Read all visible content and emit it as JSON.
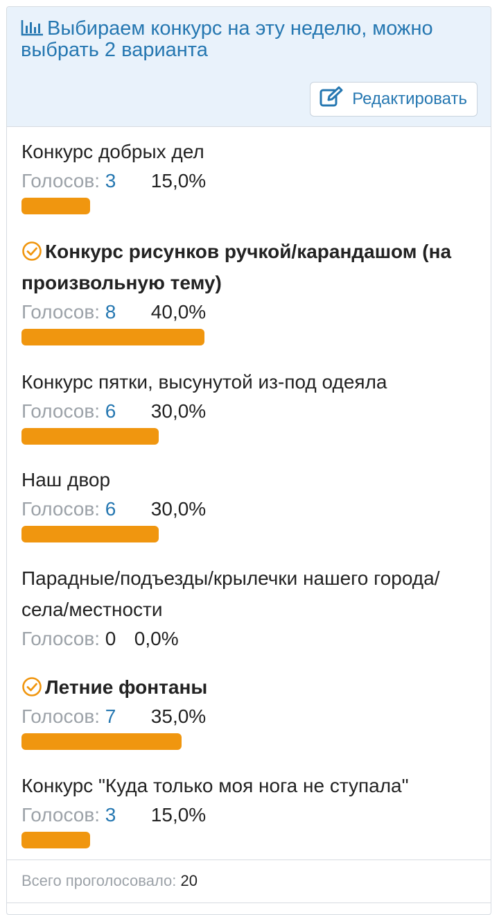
{
  "poll": {
    "title": "Выбираем конкурс на эту неделю, можно выбрать 2 варианта",
    "edit_label": "Редактировать",
    "votes_label": "Голосов:",
    "options": [
      {
        "label": "Конкурс добрых дел",
        "votes": "3",
        "percent": "15,0%",
        "share": 0.15,
        "selected": false
      },
      {
        "label": "Конкурс рисунков ручкой/карандашом (на произвольную тему)",
        "votes": "8",
        "percent": "40,0%",
        "share": 0.4,
        "selected": true
      },
      {
        "label": "Конкурс пятки, высунутой из-под одеяла",
        "votes": "6",
        "percent": "30,0%",
        "share": 0.3,
        "selected": false
      },
      {
        "label": "Наш двор",
        "votes": "6",
        "percent": "30,0%",
        "share": 0.3,
        "selected": false
      },
      {
        "label": "Парадные/подъезды/крылечки нашего города/села/местности",
        "votes": "0",
        "percent": "0,0%",
        "share": 0.0,
        "selected": false
      },
      {
        "label": "Летние фонтаны",
        "votes": "7",
        "percent": "35,0%",
        "share": 0.35,
        "selected": true
      },
      {
        "label": "Конкурс \"Куда только моя нога не ступала\"",
        "votes": "3",
        "percent": "15,0%",
        "share": 0.15,
        "selected": false
      }
    ],
    "total_label": "Всего проголосовало:",
    "total": "20"
  },
  "colors": {
    "accent": "#2577b1",
    "bar": "#f0960f",
    "header_bg": "#e9f2fb"
  },
  "icons": {
    "title": "bar-chart-icon",
    "edit": "edit-square-pen-icon",
    "selected": "check-circle-icon"
  }
}
